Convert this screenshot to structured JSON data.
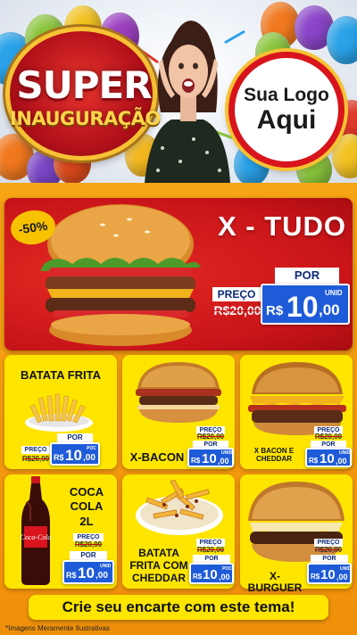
{
  "header": {
    "badge_line1": "SUPER",
    "badge_line2": "INAUGURAÇÃO",
    "logo_line1": "Sua Logo",
    "logo_line2": "Aqui"
  },
  "hero": {
    "discount": "-50%",
    "title": "X - TUDO",
    "preco_label": "PREÇO",
    "old_price": "R$20,00",
    "por_label": "POR",
    "currency": "R$",
    "price_int": "10",
    "price_dec": ",00",
    "unit": "UNID"
  },
  "products": [
    {
      "name": "BATATA FRITA",
      "preco_label": "PREÇO",
      "old_price": "R$20,00",
      "por_label": "POR",
      "currency": "R$",
      "price_int": "10",
      "price_dec": ",00",
      "unit": "POC"
    },
    {
      "name": "X-BACON",
      "preco_label": "PREÇO",
      "old_price": "R$20,00",
      "por_label": "POR",
      "currency": "R$",
      "price_int": "10",
      "price_dec": ",00",
      "unit": "UNID"
    },
    {
      "name": "X BACON E CHEDDAR",
      "preco_label": "PREÇO",
      "old_price": "R$20,00",
      "por_label": "POR",
      "currency": "R$",
      "price_int": "10",
      "price_dec": ",00",
      "unit": "UNID"
    },
    {
      "name": "COCA COLA 2L",
      "preco_label": "PREÇO",
      "old_price": "R$20,00",
      "por_label": "POR",
      "currency": "R$",
      "price_int": "10",
      "price_dec": ",00",
      "unit": "UNID"
    },
    {
      "name": "BATATA FRITA COM CHEDDAR",
      "preco_label": "PREÇO",
      "old_price": "R$20,00",
      "por_label": "POR",
      "currency": "R$",
      "price_int": "10",
      "price_dec": ",00",
      "unit": "POC"
    },
    {
      "name": "X-BURGUER",
      "preco_label": "PREÇO",
      "old_price": "R$20,00",
      "por_label": "POR",
      "currency": "R$",
      "price_int": "10",
      "price_dec": ",00",
      "unit": "UNID"
    }
  ],
  "bottle_logo": "Coca-Cola",
  "footer": {
    "cta": "Crie seu encarte com este tema!",
    "disclaimer": "*Imagens Meramente Ilustrativas"
  },
  "colors": {
    "background_orange": "#f4a20c",
    "card_yellow": "#fde500",
    "hero_red": "#c91419",
    "price_blue": "#1e5bd8",
    "label_navy": "#0d2a78"
  },
  "icons": [
    "balloon-icon",
    "burger-icon",
    "fries-icon",
    "soda-bottle-icon",
    "woman-photo"
  ]
}
